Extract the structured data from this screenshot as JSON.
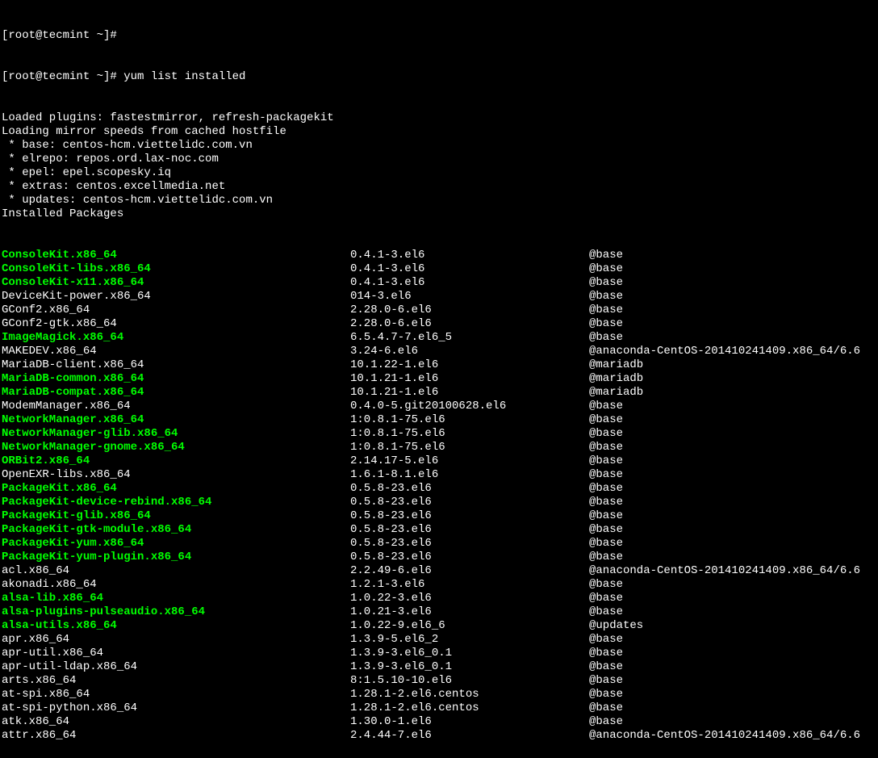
{
  "prompts": [
    "[root@tecmint ~]# ",
    "[root@tecmint ~]# "
  ],
  "command": "yum list installed",
  "header_lines": [
    "Loaded plugins: fastestmirror, refresh-packagekit",
    "Loading mirror speeds from cached hostfile",
    " * base: centos-hcm.viettelidc.com.vn",
    " * elrepo: repos.ord.lax-noc.com",
    " * epel: epel.scopesky.iq",
    " * extras: centos.excellmedia.net",
    " * updates: centos-hcm.viettelidc.com.vn",
    "Installed Packages"
  ],
  "packages": [
    {
      "name": "ConsoleKit.x86_64",
      "version": "0.4.1-3.el6",
      "repo": "@base",
      "hl": true
    },
    {
      "name": "ConsoleKit-libs.x86_64",
      "version": "0.4.1-3.el6",
      "repo": "@base",
      "hl": true
    },
    {
      "name": "ConsoleKit-x11.x86_64",
      "version": "0.4.1-3.el6",
      "repo": "@base",
      "hl": true
    },
    {
      "name": "DeviceKit-power.x86_64",
      "version": "014-3.el6",
      "repo": "@base",
      "hl": false
    },
    {
      "name": "GConf2.x86_64",
      "version": "2.28.0-6.el6",
      "repo": "@base",
      "hl": false
    },
    {
      "name": "GConf2-gtk.x86_64",
      "version": "2.28.0-6.el6",
      "repo": "@base",
      "hl": false
    },
    {
      "name": "ImageMagick.x86_64",
      "version": "6.5.4.7-7.el6_5",
      "repo": "@base",
      "hl": true
    },
    {
      "name": "MAKEDEV.x86_64",
      "version": "3.24-6.el6",
      "repo": "@anaconda-CentOS-201410241409.x86_64/6.6",
      "hl": false
    },
    {
      "name": "MariaDB-client.x86_64",
      "version": "10.1.22-1.el6",
      "repo": "@mariadb",
      "hl": false
    },
    {
      "name": "MariaDB-common.x86_64",
      "version": "10.1.21-1.el6",
      "repo": "@mariadb",
      "hl": true
    },
    {
      "name": "MariaDB-compat.x86_64",
      "version": "10.1.21-1.el6",
      "repo": "@mariadb",
      "hl": true
    },
    {
      "name": "ModemManager.x86_64",
      "version": "0.4.0-5.git20100628.el6",
      "repo": "@base",
      "hl": false
    },
    {
      "name": "NetworkManager.x86_64",
      "version": "1:0.8.1-75.el6",
      "repo": "@base",
      "hl": true
    },
    {
      "name": "NetworkManager-glib.x86_64",
      "version": "1:0.8.1-75.el6",
      "repo": "@base",
      "hl": true
    },
    {
      "name": "NetworkManager-gnome.x86_64",
      "version": "1:0.8.1-75.el6",
      "repo": "@base",
      "hl": true
    },
    {
      "name": "ORBit2.x86_64",
      "version": "2.14.17-5.el6",
      "repo": "@base",
      "hl": true
    },
    {
      "name": "OpenEXR-libs.x86_64",
      "version": "1.6.1-8.1.el6",
      "repo": "@base",
      "hl": false
    },
    {
      "name": "PackageKit.x86_64",
      "version": "0.5.8-23.el6",
      "repo": "@base",
      "hl": true
    },
    {
      "name": "PackageKit-device-rebind.x86_64",
      "version": "0.5.8-23.el6",
      "repo": "@base",
      "hl": true
    },
    {
      "name": "PackageKit-glib.x86_64",
      "version": "0.5.8-23.el6",
      "repo": "@base",
      "hl": true
    },
    {
      "name": "PackageKit-gtk-module.x86_64",
      "version": "0.5.8-23.el6",
      "repo": "@base",
      "hl": true
    },
    {
      "name": "PackageKit-yum.x86_64",
      "version": "0.5.8-23.el6",
      "repo": "@base",
      "hl": true
    },
    {
      "name": "PackageKit-yum-plugin.x86_64",
      "version": "0.5.8-23.el6",
      "repo": "@base",
      "hl": true
    },
    {
      "name": "acl.x86_64",
      "version": "2.2.49-6.el6",
      "repo": "@anaconda-CentOS-201410241409.x86_64/6.6",
      "hl": false
    },
    {
      "name": "akonadi.x86_64",
      "version": "1.2.1-3.el6",
      "repo": "@base",
      "hl": false
    },
    {
      "name": "alsa-lib.x86_64",
      "version": "1.0.22-3.el6",
      "repo": "@base",
      "hl": true
    },
    {
      "name": "alsa-plugins-pulseaudio.x86_64",
      "version": "1.0.21-3.el6",
      "repo": "@base",
      "hl": true
    },
    {
      "name": "alsa-utils.x86_64",
      "version": "1.0.22-9.el6_6",
      "repo": "@updates",
      "hl": true
    },
    {
      "name": "apr.x86_64",
      "version": "1.3.9-5.el6_2",
      "repo": "@base",
      "hl": false
    },
    {
      "name": "apr-util.x86_64",
      "version": "1.3.9-3.el6_0.1",
      "repo": "@base",
      "hl": false
    },
    {
      "name": "apr-util-ldap.x86_64",
      "version": "1.3.9-3.el6_0.1",
      "repo": "@base",
      "hl": false
    },
    {
      "name": "arts.x86_64",
      "version": "8:1.5.10-10.el6",
      "repo": "@base",
      "hl": false
    },
    {
      "name": "at-spi.x86_64",
      "version": "1.28.1-2.el6.centos",
      "repo": "@base",
      "hl": false
    },
    {
      "name": "at-spi-python.x86_64",
      "version": "1.28.1-2.el6.centos",
      "repo": "@base",
      "hl": false
    },
    {
      "name": "atk.x86_64",
      "version": "1.30.0-1.el6",
      "repo": "@base",
      "hl": false
    },
    {
      "name": "attr.x86_64",
      "version": "2.4.44-7.el6",
      "repo": "@anaconda-CentOS-201410241409.x86_64/6.6",
      "hl": false
    }
  ]
}
